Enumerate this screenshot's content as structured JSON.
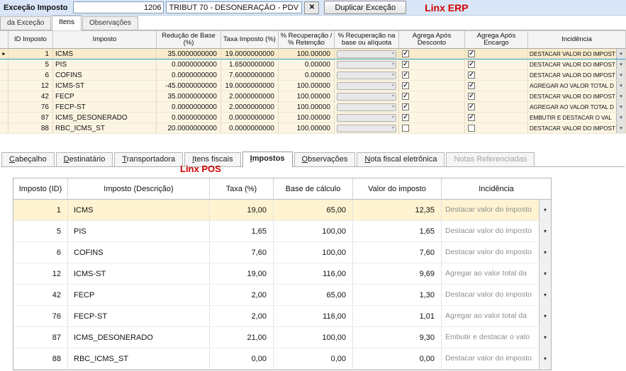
{
  "colors": {
    "brand_red": "#d40000",
    "erp_row": "#fcf5e3",
    "erp_sel": "#f9ebcb",
    "pos_sel": "#fff3d1"
  },
  "icons": {
    "close": "✕",
    "chevron_down": "▾",
    "check": "✓",
    "row_pointer": "►"
  },
  "erp": {
    "brand": "Linx ERP",
    "header": {
      "title": "Exceção Imposto",
      "code": "1206",
      "description": "TRIBUT 70 - DESONERAÇÃO - PDV",
      "duplicate_button": "Duplicar Exceção"
    },
    "tabs": [
      {
        "label": "da Exceção",
        "active": false
      },
      {
        "label": "Itens",
        "active": true
      },
      {
        "label": "Observações",
        "active": false
      }
    ],
    "grid": {
      "columns": [
        "ID Imposto",
        "Imposto",
        "Redução de Base (%)",
        "Taxa Imposto (%)",
        "% Recuperação /\n% Retenção",
        "% Recuperação na\nbase ou alíquota",
        "Agrega Após Desconto",
        "Agrega Após Encargo",
        "Incidência"
      ],
      "rows": [
        {
          "id": "1",
          "imposto": "ICMS",
          "reducao_base": "35.0000000000",
          "taxa": "19.0000000000",
          "recuperacao": "100.00000",
          "agrega_desconto": true,
          "agrega_encargo": true,
          "incidencia": "DESTACAR VALOR DO IMPOST",
          "selected": true
        },
        {
          "id": "5",
          "imposto": "PIS",
          "reducao_base": "0.0000000000",
          "taxa": "1.6500000000",
          "recuperacao": "0.00000",
          "agrega_desconto": true,
          "agrega_encargo": true,
          "incidencia": "DESTACAR VALOR DO IMPOST",
          "selected": false
        },
        {
          "id": "6",
          "imposto": "COFINS",
          "reducao_base": "0.0000000000",
          "taxa": "7.6000000000",
          "recuperacao": "0.00000",
          "agrega_desconto": true,
          "agrega_encargo": true,
          "incidencia": "DESTACAR VALOR DO IMPOST",
          "selected": false
        },
        {
          "id": "12",
          "imposto": "ICMS-ST",
          "reducao_base": "-45.0000000000",
          "taxa": "19.0000000000",
          "recuperacao": "100.00000",
          "agrega_desconto": true,
          "agrega_encargo": true,
          "incidencia": "AGREGAR AO VALOR TOTAL D",
          "selected": false
        },
        {
          "id": "42",
          "imposto": "FECP",
          "reducao_base": "35.0000000000",
          "taxa": "2.0000000000",
          "recuperacao": "100.00000",
          "agrega_desconto": true,
          "agrega_encargo": true,
          "incidencia": "DESTACAR VALOR DO IMPOST",
          "selected": false
        },
        {
          "id": "76",
          "imposto": "FECP-ST",
          "reducao_base": "0.0000000000",
          "taxa": "2.0000000000",
          "recuperacao": "100.00000",
          "agrega_desconto": true,
          "agrega_encargo": true,
          "incidencia": "AGREGAR AO VALOR TOTAL D",
          "selected": false
        },
        {
          "id": "87",
          "imposto": "ICMS_DESONERADO",
          "reducao_base": "0.0000000000",
          "taxa": "0.0000000000",
          "recuperacao": "100.00000",
          "agrega_desconto": true,
          "agrega_encargo": true,
          "incidencia": "EMBUTIR E DESTACAR O VAL",
          "selected": false
        },
        {
          "id": "88",
          "imposto": "RBC_ICMS_ST",
          "reducao_base": "20.0000000000",
          "taxa": "0.0000000000",
          "recuperacao": "100.00000",
          "agrega_desconto": false,
          "agrega_encargo": false,
          "incidencia": "DESTACAR VALOR DO IMPOST",
          "selected": false
        }
      ]
    }
  },
  "pos": {
    "brand": "Linx POS",
    "tabs": [
      {
        "label": "Cabeçalho",
        "active": false,
        "disabled": false
      },
      {
        "label": "Destinatário",
        "active": false,
        "disabled": false
      },
      {
        "label": "Transportadora",
        "active": false,
        "disabled": false
      },
      {
        "label": "Itens fiscais",
        "active": false,
        "disabled": false
      },
      {
        "label": "Impostos",
        "active": true,
        "disabled": false
      },
      {
        "label": "Observações",
        "active": false,
        "disabled": false
      },
      {
        "label": "Nota fiscal eletrônica",
        "active": false,
        "disabled": false
      },
      {
        "label": "Notas Referenciadas",
        "active": false,
        "disabled": true
      }
    ],
    "table": {
      "columns": [
        "Imposto (ID)",
        "Imposto (Descrição)",
        "Taxa (%)",
        "Base de cálculo",
        "Valor do imposto",
        "Incidência"
      ],
      "rows": [
        {
          "id": "1",
          "descricao": "ICMS",
          "taxa": "19,00",
          "base": "65,00",
          "valor": "12,35",
          "incidencia": "Destacar valor do imposto",
          "selected": true
        },
        {
          "id": "5",
          "descricao": "PIS",
          "taxa": "1,65",
          "base": "100,00",
          "valor": "1,65",
          "incidencia": "Destacar valor do imposto",
          "selected": false
        },
        {
          "id": "6",
          "descricao": "COFINS",
          "taxa": "7,60",
          "base": "100,00",
          "valor": "7,60",
          "incidencia": "Destacar valor do imposto",
          "selected": false
        },
        {
          "id": "12",
          "descricao": "ICMS-ST",
          "taxa": "19,00",
          "base": "116,00",
          "valor": "9,69",
          "incidencia": "Agregar ao valor total da",
          "selected": false
        },
        {
          "id": "42",
          "descricao": "FECP",
          "taxa": "2,00",
          "base": "65,00",
          "valor": "1,30",
          "incidencia": "Destacar valor do imposto",
          "selected": false
        },
        {
          "id": "76",
          "descricao": "FECP-ST",
          "taxa": "2,00",
          "base": "116,00",
          "valor": "1,01",
          "incidencia": "Agregar ao valor total da",
          "selected": false
        },
        {
          "id": "87",
          "descricao": "ICMS_DESONERADO",
          "taxa": "21,00",
          "base": "100,00",
          "valor": "9,30",
          "incidencia": "Embutir e destacar o valo",
          "selected": false
        },
        {
          "id": "88",
          "descricao": "RBC_ICMS_ST",
          "taxa": "0,00",
          "base": "0,00",
          "valor": "0,00",
          "incidencia": "Destacar valor do imposto",
          "selected": false
        }
      ]
    }
  }
}
